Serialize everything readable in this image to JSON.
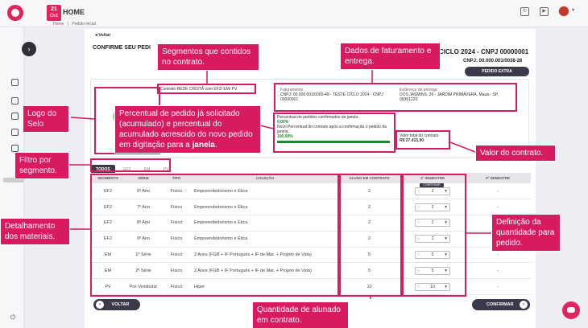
{
  "header": {
    "date_day": "21",
    "date_month": "Out",
    "title": "HOME",
    "breadcrumbs": [
      "Home",
      "|",
      "Pedido inicial"
    ]
  },
  "page": {
    "back_label": "Voltar",
    "title": "CONFIRME SEU PEDI",
    "cycle_title": "CICLO 2024 - CNPJ 00000001",
    "cnpj_right": "CNPJ: 00.000.001/0038-28",
    "extra_button": "PEDIDO EXTRA"
  },
  "contract": {
    "segments_text": "Contrato REDE CRISTÃ com EF2/ EM/ PV",
    "billing_label": "Faturamento",
    "billing_value": "CNPJ: 00.000.001/0000-48 - TESTE CICLO 2024 - CNPJ 00000001",
    "delivery_label": "Endereço de entrega",
    "delivery_value": "DOS JASMINS, 26 - JARDIM PRIMAVERA, Mauá - SP, 09361220",
    "pct_confirmed_label": "Percentual de pedidos confirmados da janela:",
    "pct_confirmed_value": "0,00%",
    "pct_new_label": "Novo Percentual do contrato após a confirmação o pedido da janela:",
    "pct_new_value": "100,00%",
    "pct_new_fraction": 1.0,
    "total_label": "Valor total do contrato",
    "total_value": "R$ 27.415,90"
  },
  "tabs": [
    "TODOS",
    "EF2",
    "EM",
    "PV"
  ],
  "table": {
    "headers": [
      "SEGMENTO",
      "SÉRIE",
      "TIPO",
      "COLEÇÃO",
      "ALUNO EM CONTRATO",
      "1º SEMESTRE",
      "2º SEMESTRE"
    ],
    "confirm_small": "CONFIRMAR",
    "rows": [
      {
        "segmento": "EF2",
        "serie": "6º Ano",
        "tipo": "Físico",
        "colecao": "Empreendedorismo e Ética",
        "alunos": "2",
        "sem1": "2",
        "sem2": "-"
      },
      {
        "segmento": "EF2",
        "serie": "7º Ano",
        "tipo": "Físico",
        "colecao": "Empreendedorismo e Ética",
        "alunos": "2",
        "sem1": "2",
        "sem2": "-"
      },
      {
        "segmento": "EF2",
        "serie": "8º Ano",
        "tipo": "Físico",
        "colecao": "Empreendedorismo e Ética",
        "alunos": "2",
        "sem1": "2",
        "sem2": "-"
      },
      {
        "segmento": "EF2",
        "serie": "9º Ano",
        "tipo": "Físico",
        "colecao": "Empreendedorismo e Ética",
        "alunos": "2",
        "sem1": "2",
        "sem2": "-"
      },
      {
        "segmento": "EM",
        "serie": "1ª Série",
        "tipo": "Físico",
        "colecao": "2 Anos (FGB + IF Português + IF de Mat. + Projeto de Vida)",
        "alunos": "5",
        "sem1": "5",
        "sem2": "-"
      },
      {
        "segmento": "EM",
        "serie": "2ª Série",
        "tipo": "Físico",
        "colecao": "2 Anos (FGB + IF Português + IF de Mat. + Projeto de Vida)",
        "alunos": "5",
        "sem1": "5",
        "sem2": "-"
      },
      {
        "segmento": "PV",
        "serie": "Pré-Vestibular",
        "tipo": "Físico",
        "colecao": "Hiper",
        "alunos": "10",
        "sem1": "10",
        "sem2": "-"
      }
    ]
  },
  "footer": {
    "back_button": "VOLTAR",
    "confirm_button": "CONFIRMAR"
  },
  "annotations": {
    "segmentos": "Segmentos que contidos no contrato.",
    "dados": "Dados de faturamento e entrega.",
    "logo": "Logo do Selo",
    "percentual": "Percentual de pedido já solicitado (acumulado) e percentual do acumulado acrescido do novo pedido em digitação para a",
    "percentual_bold": "janela",
    "percentual_end": ".",
    "filtro": "Filtro por segmento.",
    "valor": "Valor do contrato.",
    "detalhamento": "Detalhamento dos materiais.",
    "definicao": "Definição da quantidade para pedido.",
    "quantidade": "Quantidade de alunado em contrato."
  },
  "colors": {
    "accent": "#e0245e",
    "annotation": "#d81b60",
    "dark_button": "#3a3a4a",
    "progress": "#1a8a2a"
  },
  "icons": [
    "calendar-icon",
    "refresh-icon",
    "youtube-icon",
    "gear-icon",
    "chevron-right-icon",
    "power-icon",
    "chat-icon",
    "minus-icon",
    "chevron-down-icon",
    "chevron-left-icon"
  ]
}
